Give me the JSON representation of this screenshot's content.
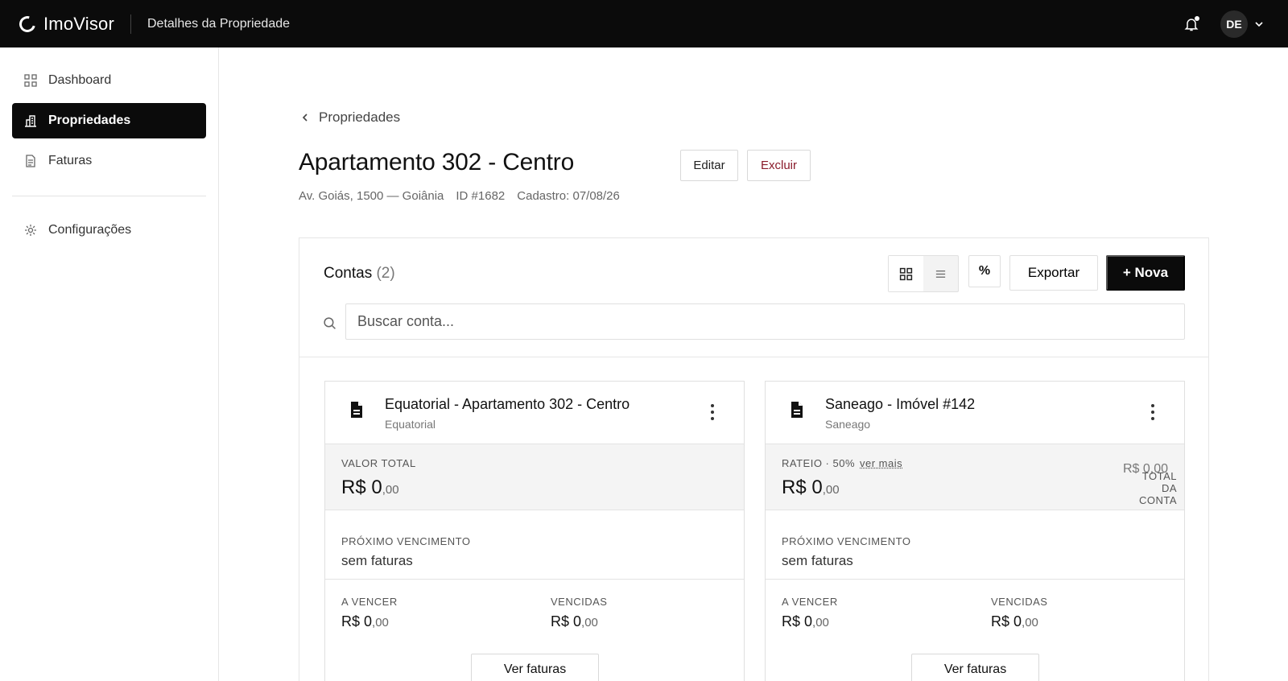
{
  "app": {
    "name": "ImoVisor",
    "page_title": "Detalhes da Propriedade",
    "user_initials": "DE"
  },
  "sidebar": {
    "items": [
      {
        "label": "Dashboard",
        "icon": "grid-icon"
      },
      {
        "label": "Propriedades",
        "icon": "building-icon",
        "active": true
      },
      {
        "label": "Faturas",
        "icon": "document-icon"
      },
      {
        "label": "Configurações",
        "icon": "gear-icon"
      }
    ]
  },
  "breadcrumb": {
    "label": "Propriedades"
  },
  "property": {
    "title": "Apartamento 302 - Centro",
    "edit_label": "Editar",
    "delete_label": "Excluir",
    "address": "Av. Goiás, 1500 — Goiânia",
    "id_text": "ID #1682",
    "cadastro": "Cadastro: 07/08/26"
  },
  "contas": {
    "title": "Contas",
    "count": "(2)",
    "percent_symbol": "%",
    "export_label": "Exportar",
    "new_label": "+ Nova",
    "search_placeholder": "Buscar conta...",
    "cards": [
      {
        "title": "Equatorial - Apartamento 302 - Centro",
        "subtitle": "Equatorial",
        "band_label": "VALOR TOTAL",
        "value_main": "R$ 0",
        "value_cents": ",00",
        "next_label": "PRÓXIMO VENCIMENTO",
        "next_value": "sem faturas",
        "a_vencer_label": "A VENCER",
        "a_vencer_main": "R$ 0",
        "a_vencer_cents": ",00",
        "vencidas_label": "VENCIDAS",
        "vencidas_main": "R$ 0",
        "vencidas_cents": ",00",
        "button_label": "Ver faturas"
      },
      {
        "title": "Saneago - Imóvel #142",
        "subtitle": "Saneago",
        "band_label": "RATEIO · 50%",
        "band_more": "ver mais",
        "total_label": "TOTAL DA CONTA",
        "total_value": "R$ 0,00",
        "value_main": "R$ 0",
        "value_cents": ",00",
        "next_label": "PRÓXIMO VENCIMENTO",
        "next_value": "sem faturas",
        "a_vencer_label": "A VENCER",
        "a_vencer_main": "R$ 0",
        "a_vencer_cents": ",00",
        "vencidas_label": "VENCIDAS",
        "vencidas_main": "R$ 0",
        "vencidas_cents": ",00",
        "button_label": "Ver faturas"
      }
    ]
  },
  "colors": {
    "topbar": "#0b0b0b",
    "danger": "#8a1b2b",
    "band": "#f4f4f4"
  }
}
